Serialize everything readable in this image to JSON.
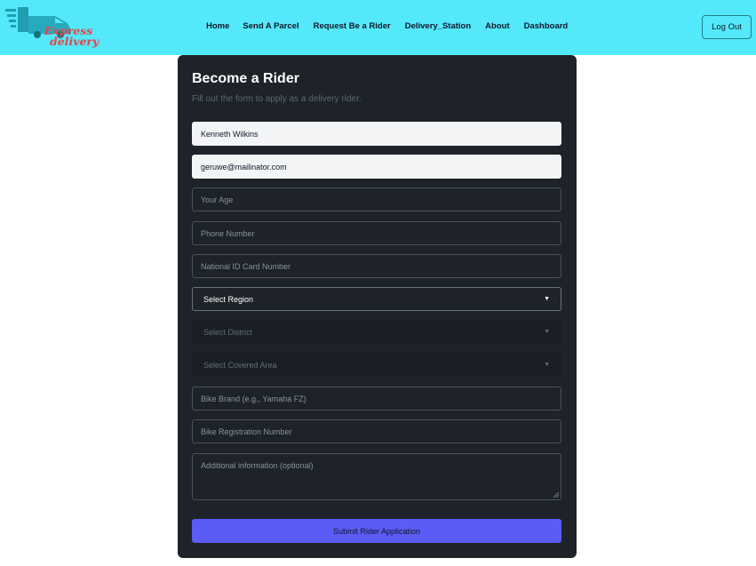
{
  "header": {
    "logo": {
      "line1": "Express",
      "line2": "delivery",
      "icon": "delivery-truck-icon"
    },
    "nav": [
      {
        "label": "Home"
      },
      {
        "label": "Send A Parcel"
      },
      {
        "label": "Request Be a Rider"
      },
      {
        "label": "Delivery_Station"
      },
      {
        "label": "About"
      },
      {
        "label": "Dashboard"
      }
    ],
    "logout_label": "Log Out"
  },
  "form": {
    "title": "Become a Rider",
    "subtitle": "Fill out the form to apply as a delivery rider.",
    "name_value": "Kenneth Wilkins",
    "email_value": "geruwe@mailinator.com",
    "age_placeholder": "Your Age",
    "phone_placeholder": "Phone Number",
    "nid_placeholder": "National ID Card Number",
    "region_selected": "Select Region",
    "district_selected": "Select District",
    "area_selected": "Select Covered Area",
    "bike_brand_placeholder": "Bike Brand (e.g., Yamaha FZ)",
    "bike_reg_placeholder": "Bike Registration Number",
    "additional_placeholder": "Additional information (optional)",
    "submit_label": "Submit Rider Application",
    "caret": "▼"
  },
  "colors": {
    "header_bg": "#54e8fb",
    "card_bg": "#1e2329",
    "accent": "#5b5bf5",
    "logo_red": "#e84545",
    "logo_teal": "#1f9fb0"
  }
}
